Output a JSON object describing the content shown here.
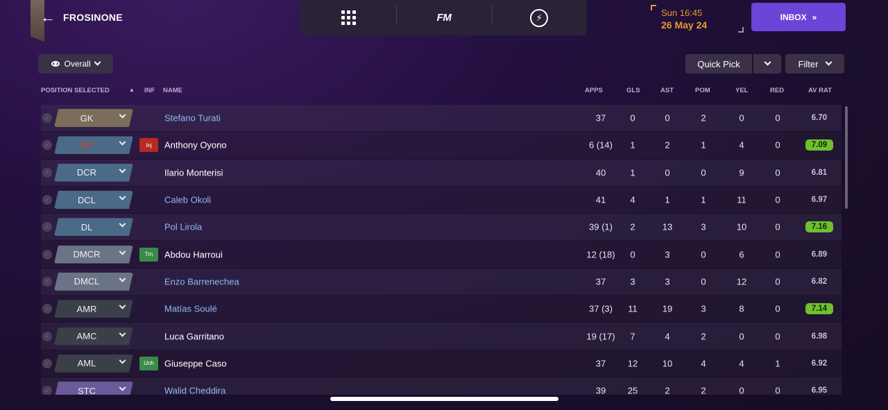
{
  "header": {
    "club_name": "FROSINONE",
    "time": "Sun 16:45",
    "date": "26 May 24",
    "nav_logo": "FM",
    "inbox_label": "INBOX",
    "inbox_icon": ">>"
  },
  "controls": {
    "view_label": "Overall",
    "quick_pick_label": "Quick Pick",
    "filter_label": "Filter"
  },
  "columns": {
    "position": "POSITION SELECTED",
    "inf": "INF",
    "name": "NAME",
    "apps": "APPS",
    "gls": "GLS",
    "ast": "AST",
    "pom": "POM",
    "yel": "YEL",
    "red": "RED",
    "av_rat": "AV RAT"
  },
  "colors": {
    "gk": "#7a6e5a",
    "defender": "#4a6a88",
    "dm": "#6a7486",
    "midfield": "#3a3f48",
    "striker": "#6a5a9a",
    "injury": "#b52a22",
    "transfer": "#3a8a4a",
    "unhappy": "#3a8a4a",
    "rating_high": "#6ec02c",
    "accent_orange": "#e89a2a",
    "inbox": "#6a45d8"
  },
  "players": [
    {
      "position": "GK",
      "pos_color": "#7a6e5a",
      "pos_text_color": "#f0ecf4",
      "inf": "",
      "inf_color": "",
      "name": "Stefano Turati",
      "name_color": "#8fb8f0",
      "apps": "37",
      "gls": "0",
      "ast": "0",
      "pom": "2",
      "yel": "0",
      "red": "0",
      "av_rat": "6.70",
      "rat_highlight": false
    },
    {
      "position": "DR",
      "pos_color": "#4a6a88",
      "pos_text_color": "#d8402a",
      "inf": "Inj",
      "inf_color": "#b52a22",
      "name": "Anthony Oyono",
      "name_color": "#ffffff",
      "apps": "6 (14)",
      "gls": "1",
      "ast": "2",
      "pom": "1",
      "yel": "4",
      "red": "0",
      "av_rat": "7.09",
      "rat_highlight": true
    },
    {
      "position": "DCR",
      "pos_color": "#4a6a88",
      "pos_text_color": "#f0ecf4",
      "inf": "",
      "inf_color": "",
      "name": "Ilario Monterisi",
      "name_color": "#ffffff",
      "apps": "40",
      "gls": "1",
      "ast": "0",
      "pom": "0",
      "yel": "9",
      "red": "0",
      "av_rat": "6.81",
      "rat_highlight": false
    },
    {
      "position": "DCL",
      "pos_color": "#4a6a88",
      "pos_text_color": "#f0ecf4",
      "inf": "",
      "inf_color": "",
      "name": "Caleb Okoli",
      "name_color": "#8fb8f0",
      "apps": "41",
      "gls": "4",
      "ast": "1",
      "pom": "1",
      "yel": "11",
      "red": "0",
      "av_rat": "6.97",
      "rat_highlight": false
    },
    {
      "position": "DL",
      "pos_color": "#4a6a88",
      "pos_text_color": "#f0ecf4",
      "inf": "",
      "inf_color": "",
      "name": "Pol Lirola",
      "name_color": "#8fb8f0",
      "apps": "39 (1)",
      "gls": "2",
      "ast": "13",
      "pom": "3",
      "yel": "10",
      "red": "0",
      "av_rat": "7.16",
      "rat_highlight": true
    },
    {
      "position": "DMCR",
      "pos_color": "#6a7486",
      "pos_text_color": "#f0ecf4",
      "inf": "Trn",
      "inf_color": "#3a8a4a",
      "name": "Abdou Harroui",
      "name_color": "#ffffff",
      "apps": "12 (18)",
      "gls": "0",
      "ast": "3",
      "pom": "0",
      "yel": "6",
      "red": "0",
      "av_rat": "6.89",
      "rat_highlight": false
    },
    {
      "position": "DMCL",
      "pos_color": "#6a7486",
      "pos_text_color": "#f0ecf4",
      "inf": "",
      "inf_color": "",
      "name": "Enzo Barrenechea",
      "name_color": "#8fb8f0",
      "apps": "37",
      "gls": "3",
      "ast": "3",
      "pom": "0",
      "yel": "12",
      "red": "0",
      "av_rat": "6.82",
      "rat_highlight": false
    },
    {
      "position": "AMR",
      "pos_color": "#3a3f48",
      "pos_text_color": "#f0ecf4",
      "inf": "",
      "inf_color": "",
      "name": "Matías Soulé",
      "name_color": "#8fb8f0",
      "apps": "37 (3)",
      "gls": "11",
      "ast": "19",
      "pom": "3",
      "yel": "8",
      "red": "0",
      "av_rat": "7.14",
      "rat_highlight": true
    },
    {
      "position": "AMC",
      "pos_color": "#3a3f48",
      "pos_text_color": "#f0ecf4",
      "inf": "",
      "inf_color": "",
      "name": "Luca Garritano",
      "name_color": "#ffffff",
      "apps": "19 (17)",
      "gls": "7",
      "ast": "4",
      "pom": "2",
      "yel": "0",
      "red": "0",
      "av_rat": "6.98",
      "rat_highlight": false
    },
    {
      "position": "AML",
      "pos_color": "#3a3f48",
      "pos_text_color": "#f0ecf4",
      "inf": "Unh",
      "inf_color": "#3a8a4a",
      "name": "Giuseppe Caso",
      "name_color": "#ffffff",
      "apps": "37",
      "gls": "12",
      "ast": "10",
      "pom": "4",
      "yel": "4",
      "red": "1",
      "av_rat": "6.92",
      "rat_highlight": false
    },
    {
      "position": "STC",
      "pos_color": "#6a5a9a",
      "pos_text_color": "#f0ecf4",
      "inf": "",
      "inf_color": "",
      "name": "Walid Cheddira",
      "name_color": "#8fb8f0",
      "apps": "39",
      "gls": "25",
      "ast": "2",
      "pom": "2",
      "yel": "0",
      "red": "0",
      "av_rat": "6.95",
      "rat_highlight": false
    }
  ]
}
